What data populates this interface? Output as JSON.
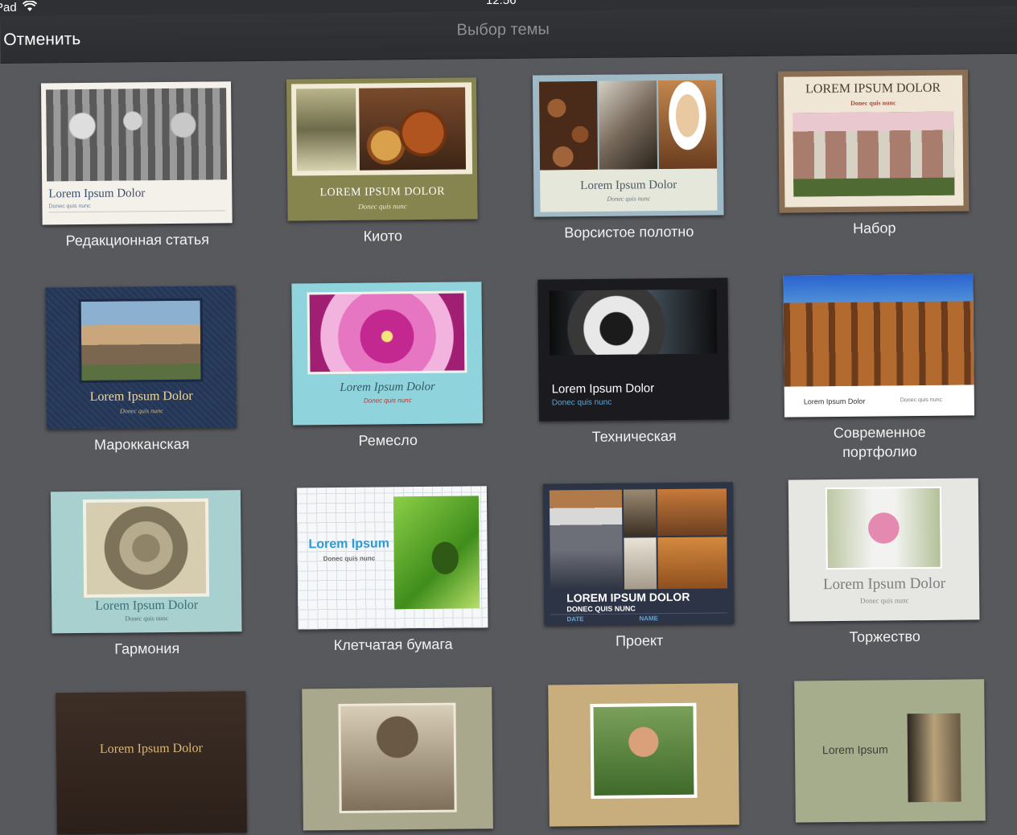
{
  "status": {
    "carrier": "Pad",
    "time": "12:56"
  },
  "nav": {
    "cancel": "Отменить",
    "title": "Выбор темы"
  },
  "colors": {
    "background": "#58595d",
    "navbar": "#2f3033",
    "title_gray": "#8f9094"
  },
  "themes": [
    {
      "label": "Редакционная статья",
      "title": "Lorem Ipsum Dolor",
      "subtitle": "Donec quis nunc"
    },
    {
      "label": "Киото",
      "title": "LOREM IPSUM DOLOR",
      "subtitle": "Donec quis nunc"
    },
    {
      "label": "Ворсистое полотно",
      "title": "Lorem Ipsum Dolor",
      "subtitle": "Donec quis nunc"
    },
    {
      "label": "Набор",
      "title": "LOREM IPSUM DOLOR",
      "subtitle": "Donec quis nunc"
    },
    {
      "label": "Марокканская",
      "title": "Lorem Ipsum Dolor",
      "subtitle": "Donec quis nunc"
    },
    {
      "label": "Ремесло",
      "title": "Lorem Ipsum Dolor",
      "subtitle": "Donec quis nunc"
    },
    {
      "label": "Техническая",
      "title": "Lorem Ipsum Dolor",
      "subtitle": "Donec quis nunc"
    },
    {
      "label_line1": "Современное",
      "label_line2": "портфолио",
      "title": "Lorem Ipsum Dolor",
      "subtitle": "Donec quis nunc"
    },
    {
      "label": "Гармония",
      "title": "Lorem Ipsum Dolor",
      "subtitle": "Donec quis nunc"
    },
    {
      "label": "Клетчатая бумага",
      "title": "Lorem Ipsum",
      "subtitle": "Donec quis nunc"
    },
    {
      "label": "Проект",
      "title": "LOREM IPSUM DOLOR",
      "subtitle": "DONEC QUIS NUNC",
      "date": "DATE",
      "name": "NAME"
    },
    {
      "label": "Торжество",
      "title": "Lorem Ipsum Dolor",
      "subtitle": "Donec quis nunc"
    },
    {
      "title": "Lorem Ipsum Dolor"
    },
    {},
    {},
    {
      "title": "Lorem Ipsum"
    }
  ]
}
